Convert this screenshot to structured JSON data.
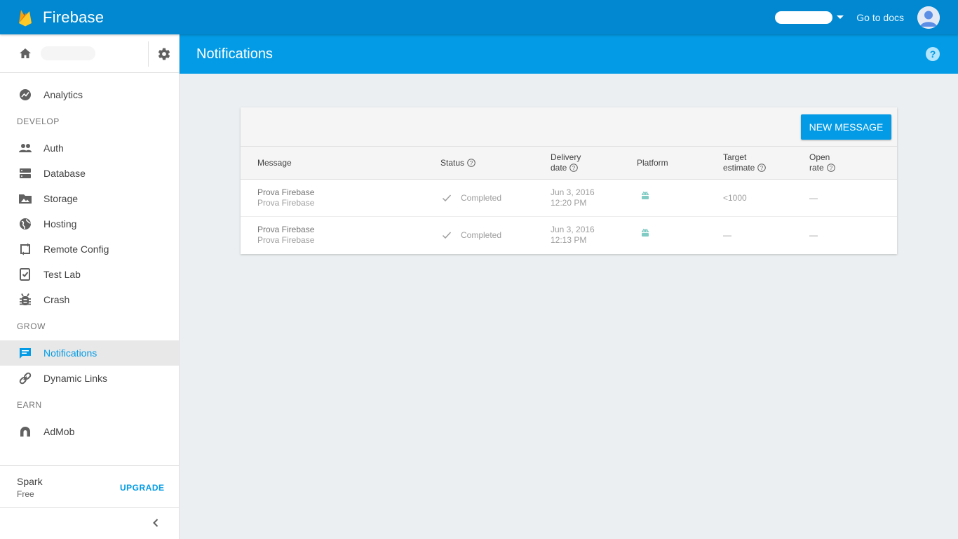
{
  "topbar": {
    "brand": "Firebase",
    "go_to_docs": "Go to docs"
  },
  "sidebar": {
    "nav": [
      {
        "type": "item",
        "label": "Analytics",
        "icon": "analytics-icon"
      },
      {
        "type": "section",
        "label": "DEVELOP"
      },
      {
        "type": "item",
        "label": "Auth",
        "icon": "auth-icon"
      },
      {
        "type": "item",
        "label": "Database",
        "icon": "database-icon"
      },
      {
        "type": "item",
        "label": "Storage",
        "icon": "storage-icon"
      },
      {
        "type": "item",
        "label": "Hosting",
        "icon": "hosting-icon"
      },
      {
        "type": "item",
        "label": "Remote Config",
        "icon": "remote-config-icon"
      },
      {
        "type": "item",
        "label": "Test Lab",
        "icon": "test-lab-icon"
      },
      {
        "type": "item",
        "label": "Crash",
        "icon": "crash-icon"
      },
      {
        "type": "section",
        "label": "GROW"
      },
      {
        "type": "item",
        "label": "Notifications",
        "icon": "notifications-icon",
        "active": true
      },
      {
        "type": "item",
        "label": "Dynamic Links",
        "icon": "dynamic-links-icon"
      },
      {
        "type": "section",
        "label": "EARN"
      },
      {
        "type": "item",
        "label": "AdMob",
        "icon": "admob-icon"
      }
    ],
    "plan": {
      "name": "Spark",
      "tier": "Free",
      "upgrade": "UPGRADE"
    }
  },
  "header": {
    "title": "Notifications"
  },
  "notifications": {
    "new_message": "NEW MESSAGE",
    "columns": {
      "message": "Message",
      "status": "Status",
      "delivery_date": [
        "Delivery",
        "date"
      ],
      "platform": "Platform",
      "target_estimate": [
        "Target",
        "estimate"
      ],
      "open_rate": [
        "Open",
        "rate"
      ]
    },
    "rows": [
      {
        "title": "Prova Firebase",
        "text": "Prova Firebase",
        "status": "Completed",
        "date": "Jun 3, 2016",
        "time": "12:20 PM",
        "platform": "android-icon",
        "target": "<1000",
        "open_rate": "—"
      },
      {
        "title": "Prova Firebase",
        "text": "Prova Firebase",
        "status": "Completed",
        "date": "Jun 3, 2016",
        "time": "12:13 PM",
        "platform": "android-icon",
        "target": "—",
        "open_rate": "—"
      }
    ]
  },
  "colors": {
    "appbar": "#0288d1",
    "header": "#039be5",
    "accent": "#039be5",
    "android": "#80cbc4"
  }
}
